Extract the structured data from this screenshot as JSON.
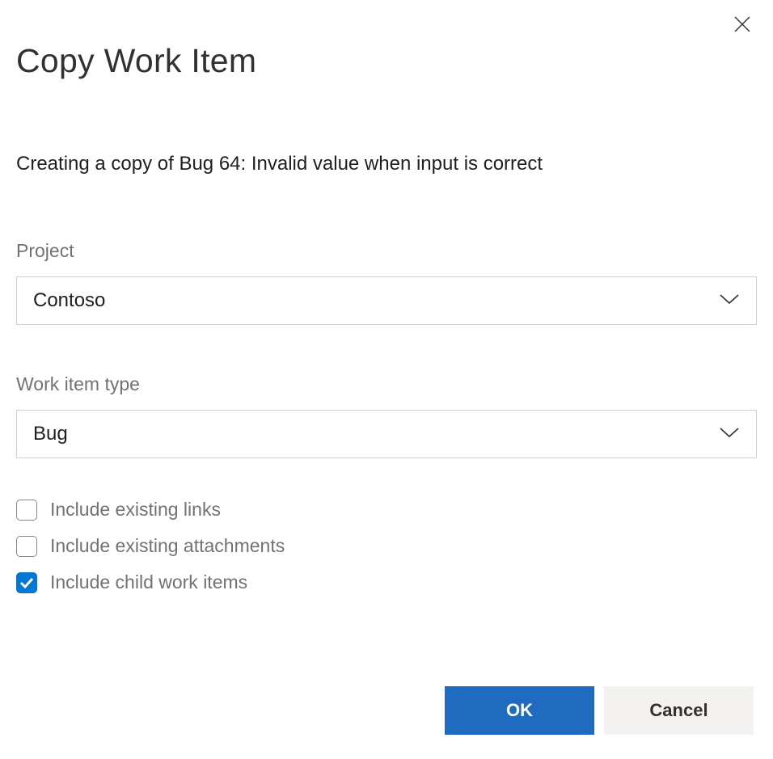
{
  "dialog": {
    "title": "Copy Work Item",
    "subtitle": "Creating a copy of Bug 64: Invalid value when input is correct"
  },
  "fields": {
    "project": {
      "label": "Project",
      "value": "Contoso"
    },
    "workItemType": {
      "label": "Work item type",
      "value": "Bug"
    }
  },
  "options": {
    "includeLinks": {
      "label": "Include existing links",
      "checked": false
    },
    "includeAttachments": {
      "label": "Include existing attachments",
      "checked": false
    },
    "includeChildren": {
      "label": "Include child work items",
      "checked": true
    }
  },
  "buttons": {
    "ok": "OK",
    "cancel": "Cancel"
  }
}
